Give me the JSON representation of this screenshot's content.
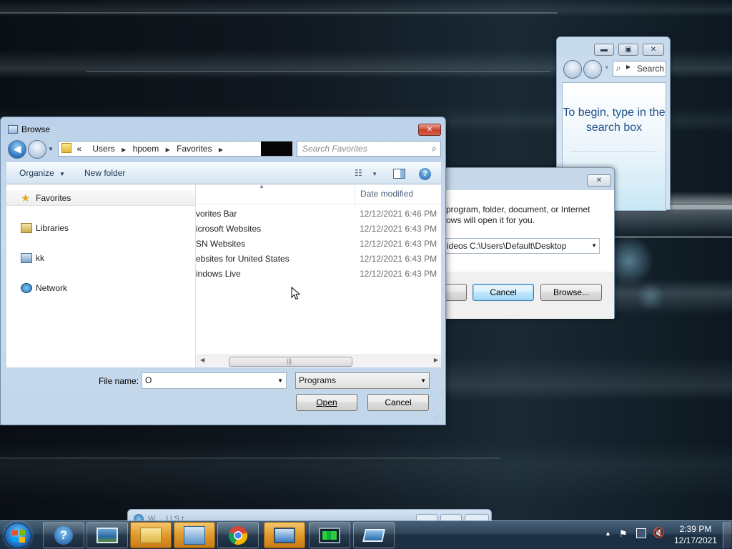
{
  "browse_dialog": {
    "title": "Browse",
    "breadcrumb": [
      "Users",
      "hpoem",
      "Favorites"
    ],
    "breadcrumb_prefix": "«",
    "search_placeholder": "Search Favorites",
    "toolbar": {
      "organize": "Organize",
      "new_folder": "New folder"
    },
    "nav_items": [
      {
        "label": "Favorites",
        "icon": "star-icon"
      },
      {
        "label": "Libraries",
        "icon": "library-icon"
      },
      {
        "label": "kk",
        "icon": "user-folder-icon"
      },
      {
        "label": "Network",
        "icon": "network-icon"
      }
    ],
    "column_header": "Date modified",
    "files": [
      {
        "name": "vorites Bar",
        "date": "12/12/2021 6:46 PM"
      },
      {
        "name": "icrosoft Websites",
        "date": "12/12/2021 6:43 PM"
      },
      {
        "name": "SN Websites",
        "date": "12/12/2021 6:43 PM"
      },
      {
        "name": "ebsites for United States",
        "date": "12/12/2021 6:43 PM"
      },
      {
        "name": "indows Live",
        "date": "12/12/2021 6:43 PM"
      }
    ],
    "file_name_label": "File name:",
    "file_name_value": "O",
    "file_type": "Programs",
    "open_button": "Open",
    "cancel_button": "Cancel"
  },
  "run_dialog": {
    "description": "program, folder, document, or Internet\nows will open it for you.",
    "open_value": "ideos C:\\Users\\Default\\Desktop",
    "cancel_button": "Cancel",
    "browse_button": "Browse..."
  },
  "search_window": {
    "search_label": "Search",
    "hint": "To begin, type in the search box"
  },
  "mini_window": {
    "title": "W   ...   l   l        S         t"
  },
  "taskbar": {
    "apps": [
      {
        "name": "help-icon",
        "hot": false
      },
      {
        "name": "picture-viewer-icon",
        "hot": false
      },
      {
        "name": "file-explorer-icon",
        "hot": true
      },
      {
        "name": "control-panel-icon",
        "hot": true
      },
      {
        "name": "chrome-icon",
        "hot": false
      },
      {
        "name": "remote-desktop-icon",
        "hot": true
      },
      {
        "name": "task-monitor-icon",
        "hot": false
      },
      {
        "name": "window-manager-icon",
        "hot": false
      }
    ],
    "time": "2:39 PM",
    "date": "12/17/2021"
  }
}
